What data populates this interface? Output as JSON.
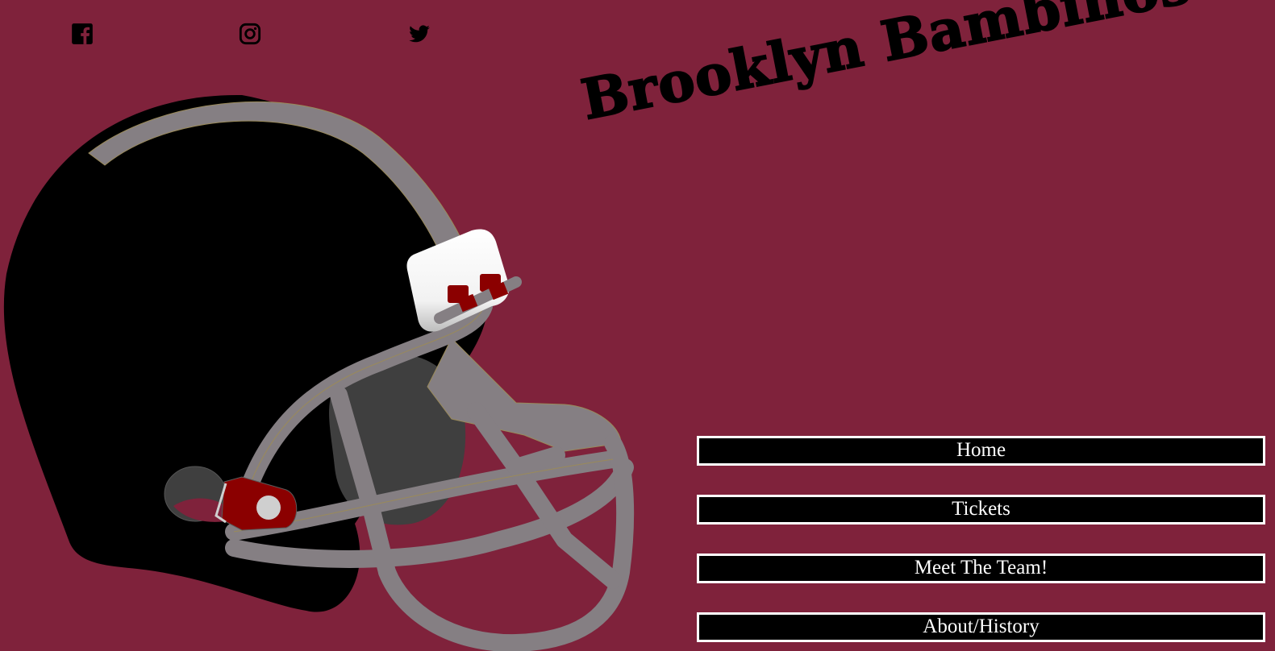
{
  "brand": {
    "title": "Brooklyn Bambinos"
  },
  "social": [
    {
      "name": "facebook-icon"
    },
    {
      "name": "instagram-icon"
    },
    {
      "name": "twitter-icon"
    }
  ],
  "nav": {
    "items": [
      {
        "label": "Home"
      },
      {
        "label": "Tickets"
      },
      {
        "label": "Meet The Team!"
      },
      {
        "label": "About/History"
      }
    ]
  },
  "colors": {
    "background": "#7f223b",
    "helmet_shell": "#000000",
    "facemask": "#857f83",
    "accent_red": "#8b0000",
    "nav_bg": "#000000",
    "nav_text": "#ffffff"
  }
}
